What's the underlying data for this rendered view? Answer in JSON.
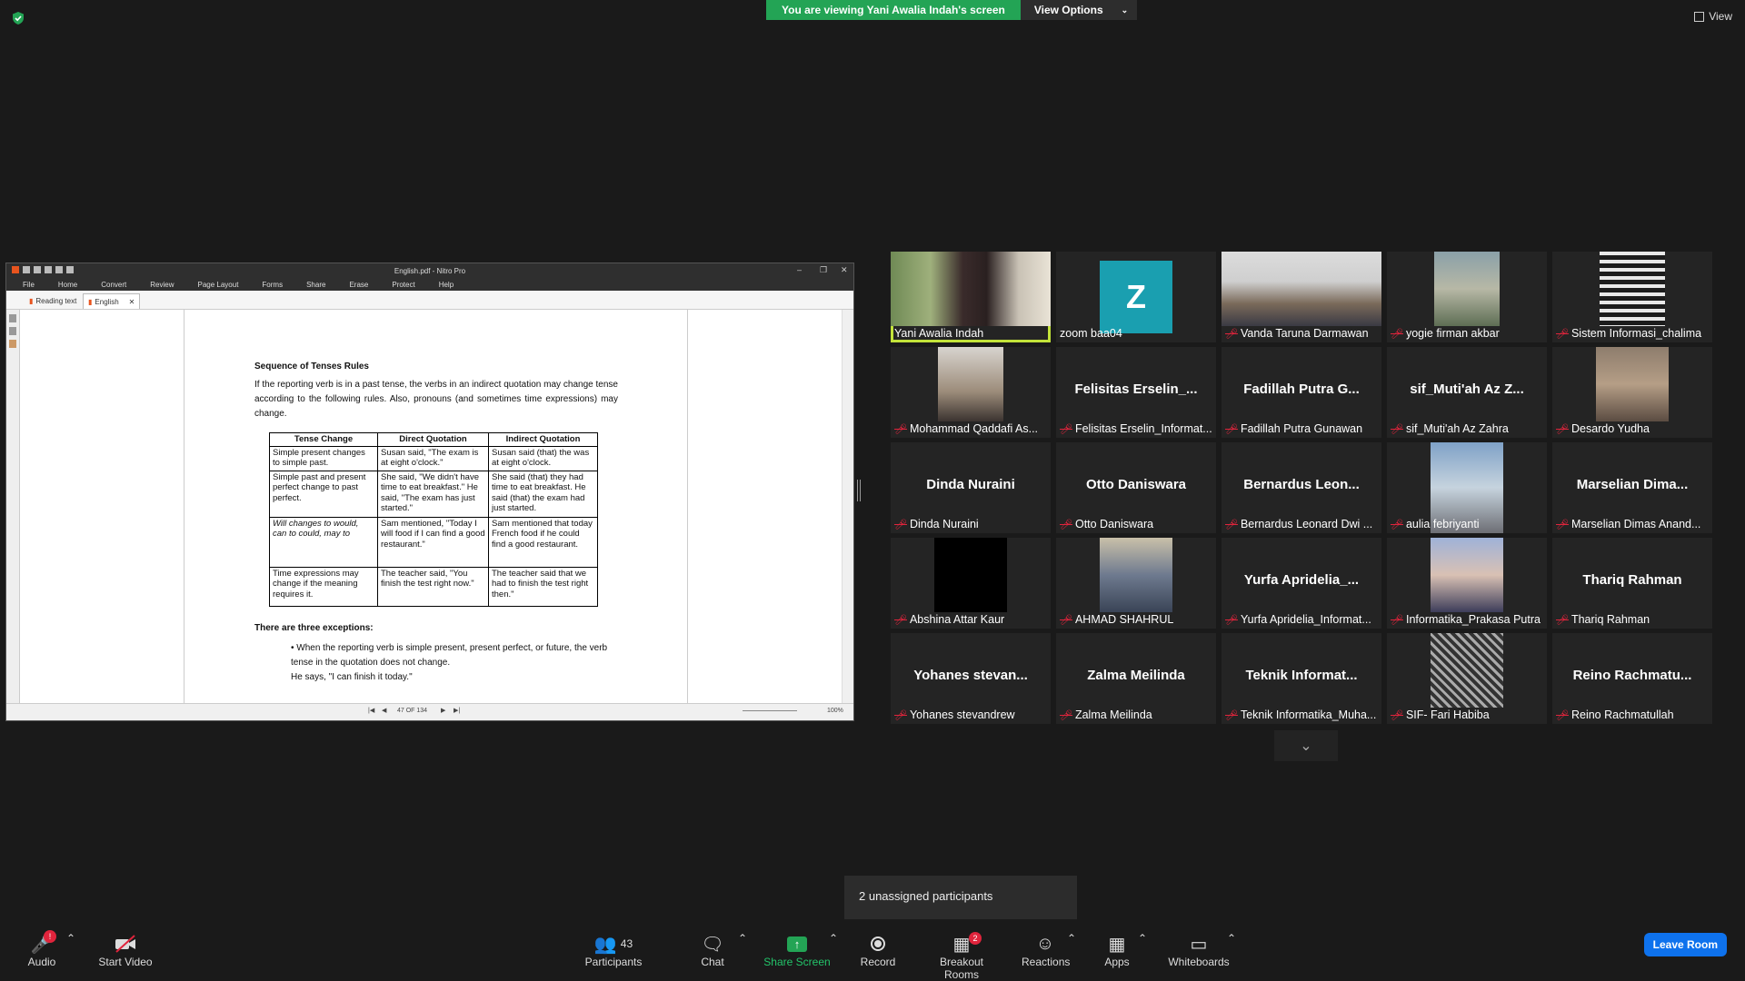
{
  "banner": {
    "viewing_text": "You are viewing Yani Awalia Indah's screen",
    "view_options": "View Options"
  },
  "view_label": "View",
  "pdf": {
    "title": "English.pdf - Nitro Pro",
    "menu": [
      "File",
      "Home",
      "Convert",
      "Review",
      "Page Layout",
      "Forms",
      "Share",
      "Erase",
      "Protect",
      "Help"
    ],
    "tabs": [
      "Reading text",
      "English"
    ],
    "page": {
      "heading": "Sequence of Tenses Rules",
      "intro": "If the reporting verb is in a past tense, the verbs in an indirect quotation may change tense according to the following rules. Also, pronouns (and sometimes time expressions) may change.",
      "table_headers": [
        "Tense Change",
        "Direct Quotation",
        "Indirect Quotation"
      ],
      "rows": [
        [
          "Simple present changes to simple past.",
          "Susan said, \"The exam is at eight o'clock.\"",
          "Susan said (that) the was at eight o'clock."
        ],
        [
          "Simple past and present perfect change to past perfect.",
          "She said, \"We didn't have time to eat breakfast.\" He said, \"The exam has just started.\"",
          "She said (that) they had time to eat breakfast. He said (that) the exam had just started."
        ],
        [
          "Will changes to would, can to could, may to",
          "Sam mentioned, \"Today I will food if I can find a good restaurant.\"",
          "Sam mentioned that today French food if he could find a good restaurant."
        ],
        [
          "Time expressions may change if the meaning requires it.",
          "The teacher said, \"You finish the test right now.\"",
          "The teacher said that we had to finish the test right then.\""
        ]
      ],
      "exceptions_title": "There are three exceptions:",
      "exception_1": "When the reporting verb is simple present, present perfect, or future, the verb tense in the quotation does not change.",
      "exception_1_example": "He says, \"I can finish it today.\""
    },
    "status": {
      "page_indicator": "47 OF 134",
      "zoom": "100%"
    }
  },
  "participants": [
    {
      "name": "Yani Awalia Indah",
      "display": "",
      "muted": false,
      "speaking": true,
      "video": "yani"
    },
    {
      "name": "zoom baa04",
      "display": "Z",
      "muted": false,
      "speaking": false,
      "video": "z"
    },
    {
      "name": "Vanda Taruna Darmawan",
      "display": "",
      "muted": true,
      "speaking": false,
      "video": "vanda"
    },
    {
      "name": "yogie firman akbar",
      "display": "",
      "muted": true,
      "speaking": false,
      "video": "yogie"
    },
    {
      "name": "Sistem Informasi_chalima",
      "display": "",
      "muted": true,
      "speaking": false,
      "video": "blinds"
    },
    {
      "name": "Mohammad Qaddafi As...",
      "display": "",
      "muted": true,
      "speaking": false,
      "video": "qaddafi"
    },
    {
      "name": "Felisitas Erselin_Informat...",
      "display": "Felisitas Erselin_...",
      "muted": true,
      "speaking": false,
      "video": ""
    },
    {
      "name": "Fadillah Putra Gunawan",
      "display": "Fadillah Putra G...",
      "muted": true,
      "speaking": false,
      "video": ""
    },
    {
      "name": "sif_Muti'ah Az Zahra",
      "display": "sif_Muti'ah Az Z...",
      "muted": true,
      "speaking": false,
      "video": ""
    },
    {
      "name": "Desardo Yudha",
      "display": "",
      "muted": true,
      "speaking": false,
      "video": "desardo"
    },
    {
      "name": "Dinda Nuraini",
      "display": "Dinda Nuraini",
      "muted": true,
      "speaking": false,
      "video": ""
    },
    {
      "name": "Otto Daniswara",
      "display": "Otto Daniswara",
      "muted": true,
      "speaking": false,
      "video": ""
    },
    {
      "name": "Bernardus Leonard Dwi ...",
      "display": "Bernardus Leon...",
      "muted": true,
      "speaking": false,
      "video": ""
    },
    {
      "name": "aulia febriyanti",
      "display": "",
      "muted": true,
      "speaking": false,
      "video": "sky"
    },
    {
      "name": "Marselian Dimas Anand...",
      "display": "Marselian Dima...",
      "muted": true,
      "speaking": false,
      "video": ""
    },
    {
      "name": "Abshina Attar Kaur",
      "display": "",
      "muted": true,
      "speaking": false,
      "video": "black"
    },
    {
      "name": "AHMAD SHAHRUL",
      "display": "",
      "muted": true,
      "speaking": false,
      "video": "mall"
    },
    {
      "name": "Yurfa Apridelia_Informat...",
      "display": "Yurfa Apridelia_...",
      "muted": true,
      "speaking": false,
      "video": ""
    },
    {
      "name": "Informatika_Prakasa Putra",
      "display": "",
      "muted": true,
      "speaking": false,
      "video": "prakasa"
    },
    {
      "name": "Thariq Rahman",
      "display": "Thariq Rahman",
      "muted": true,
      "speaking": false,
      "video": ""
    },
    {
      "name": "Yohanes stevandrew",
      "display": "Yohanes stevan...",
      "muted": true,
      "speaking": false,
      "video": ""
    },
    {
      "name": "Zalma Meilinda",
      "display": "Zalma Meilinda",
      "muted": true,
      "speaking": false,
      "video": ""
    },
    {
      "name": "Teknik Informatika_Muha...",
      "display": "Teknik Informat...",
      "muted": true,
      "speaking": false,
      "video": ""
    },
    {
      "name": "SIF- Fari Habiba",
      "display": "",
      "muted": true,
      "speaking": false,
      "video": "building"
    },
    {
      "name": "Reino Rachmatullah",
      "display": "Reino Rachmatu...",
      "muted": true,
      "speaking": false,
      "video": ""
    }
  ],
  "unassigned": "2 unassigned participants",
  "toolbar": {
    "audio": "Audio",
    "audio_badge": "!",
    "start_video": "Start Video",
    "participants": "Participants",
    "participants_count": "43",
    "chat": "Chat",
    "share_screen": "Share Screen",
    "record": "Record",
    "breakout_rooms": "Breakout Rooms",
    "breakout_badge": "2",
    "reactions": "Reactions",
    "apps": "Apps",
    "whiteboards": "Whiteboards",
    "leave": "Leave Room"
  },
  "colors": {
    "share_green": "#23a455",
    "speaker_outline": "#c3e33a",
    "leave_blue": "#0e72ed",
    "mute_red": "#e0243c"
  }
}
